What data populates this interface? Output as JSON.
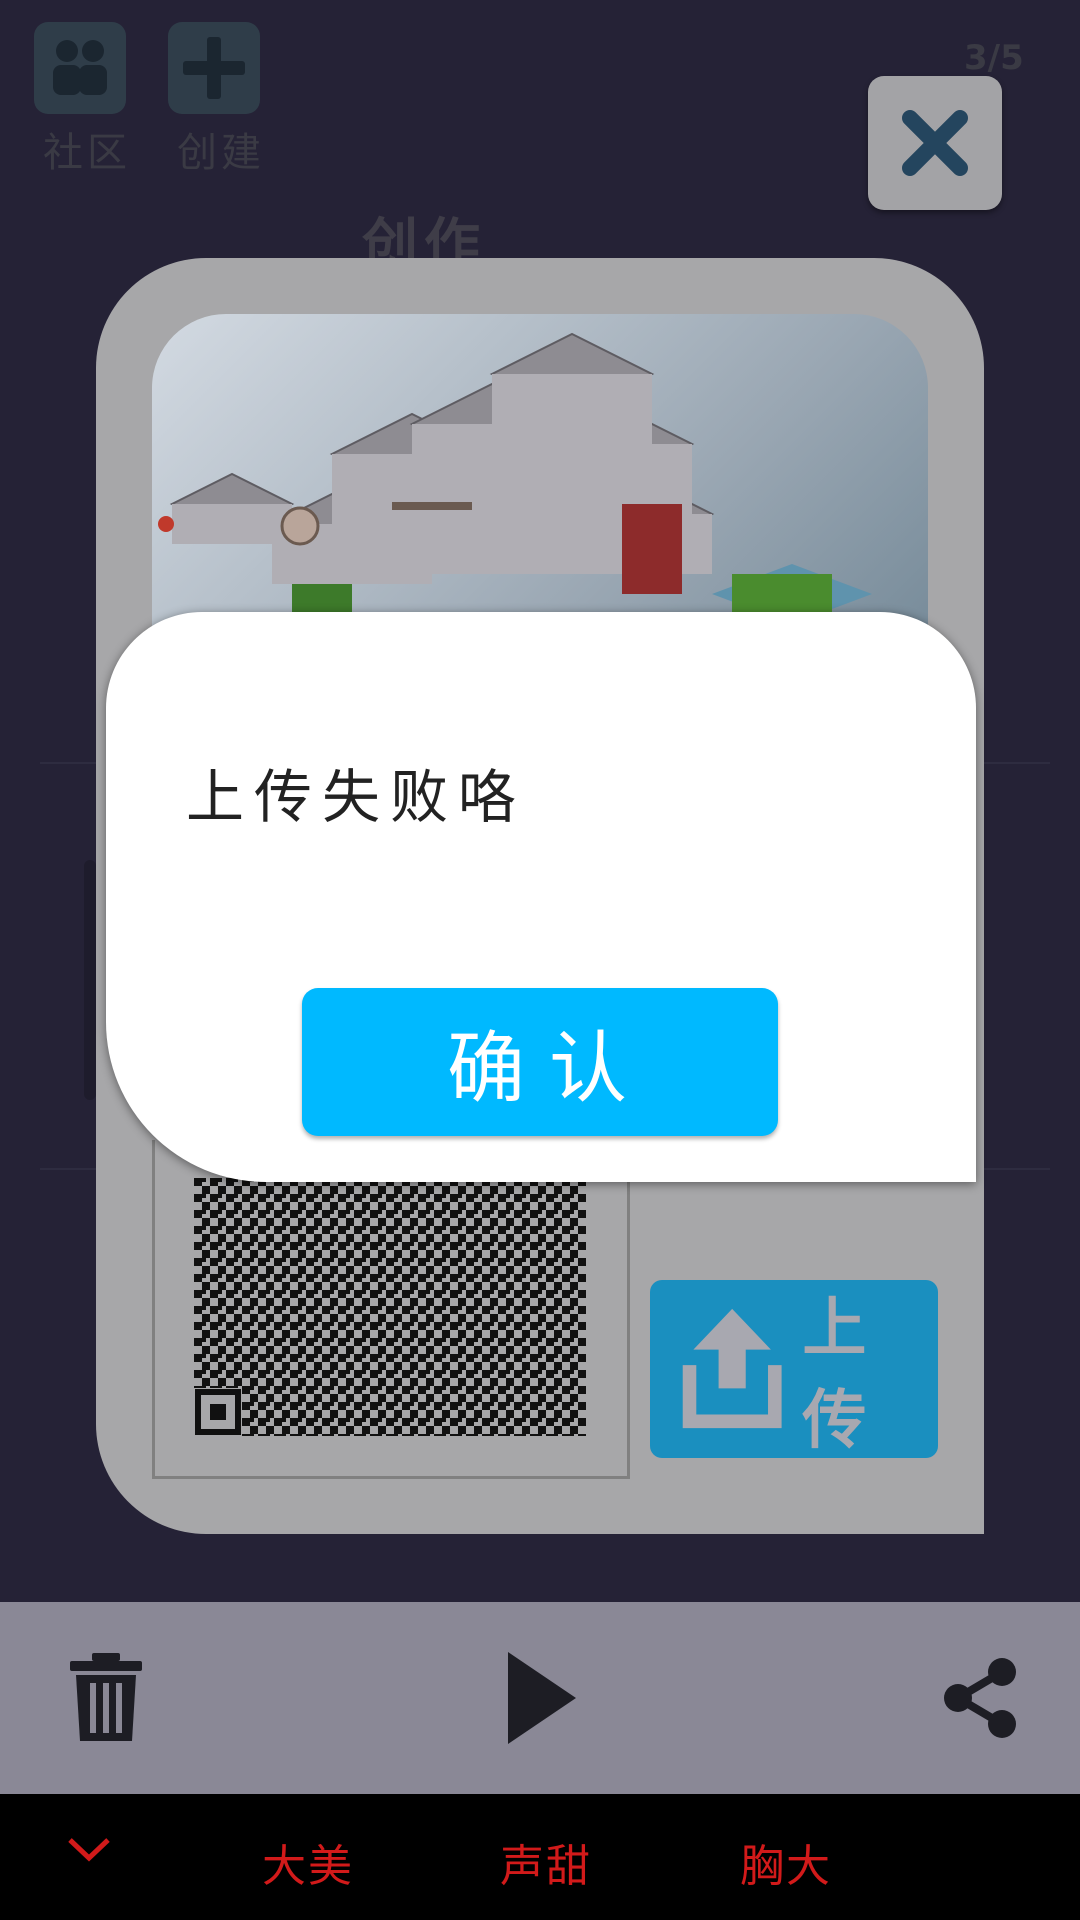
{
  "top_bar": {
    "community_label": "社区",
    "create_label": "创建",
    "page_indicator": "3/5"
  },
  "section_title": "创作",
  "upload": {
    "label": "上传"
  },
  "dialog": {
    "message": "上传失败咯",
    "confirm_label": "确认"
  },
  "system_bar": {
    "items": [
      "大美",
      "声甜",
      "胸大"
    ]
  },
  "colors": {
    "background": "#252236",
    "confirm": "#00b9ff",
    "upload": "#1a8fbf",
    "system_text": "#d21a1a"
  }
}
